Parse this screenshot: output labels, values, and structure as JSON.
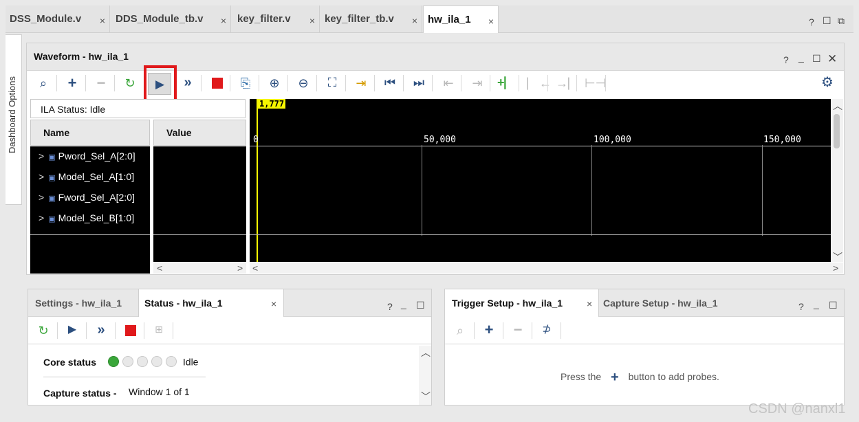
{
  "tabs": [
    {
      "label": "DSS_Module.v"
    },
    {
      "label": "DDS_Module_tb.v"
    },
    {
      "label": "key_filter.v"
    },
    {
      "label": "key_filter_tb.v"
    },
    {
      "label": "hw_ila_1",
      "active": true
    }
  ],
  "dashboard_label": "Dashboard Options",
  "waveform": {
    "title": "Waveform - hw_ila_1",
    "ila_status": "ILA Status:  Idle",
    "col_name": "Name",
    "col_value": "Value",
    "cursor_label": "1,777",
    "ruler": [
      "0",
      "50,000",
      "100,000",
      "150,000"
    ],
    "signals": [
      "Pword_Sel_A[2:0]",
      "Model_Sel_A[1:0]",
      "Fword_Sel_A[2:0]",
      "Model_Sel_B[1:0]"
    ]
  },
  "status_panel": {
    "tab_settings": "Settings - hw_ila_1",
    "tab_status": "Status - hw_ila_1",
    "core_status_label": "Core status",
    "core_status_value": "Idle",
    "capture_status_label": "Capture status -",
    "capture_status_value": "Window 1 of 1"
  },
  "trigger_panel": {
    "tab_trigger": "Trigger Setup - hw_ila_1",
    "tab_capture": "Capture Setup - hw_ila_1",
    "hint_prefix": "Press the",
    "hint_suffix": "button to add probes."
  },
  "watermark": "CSDN @nanxl1",
  "colors": {
    "highlight": "#e0191b",
    "cursor": "#f5f500",
    "run": "#2c4f7f",
    "stop": "#e0191b"
  }
}
